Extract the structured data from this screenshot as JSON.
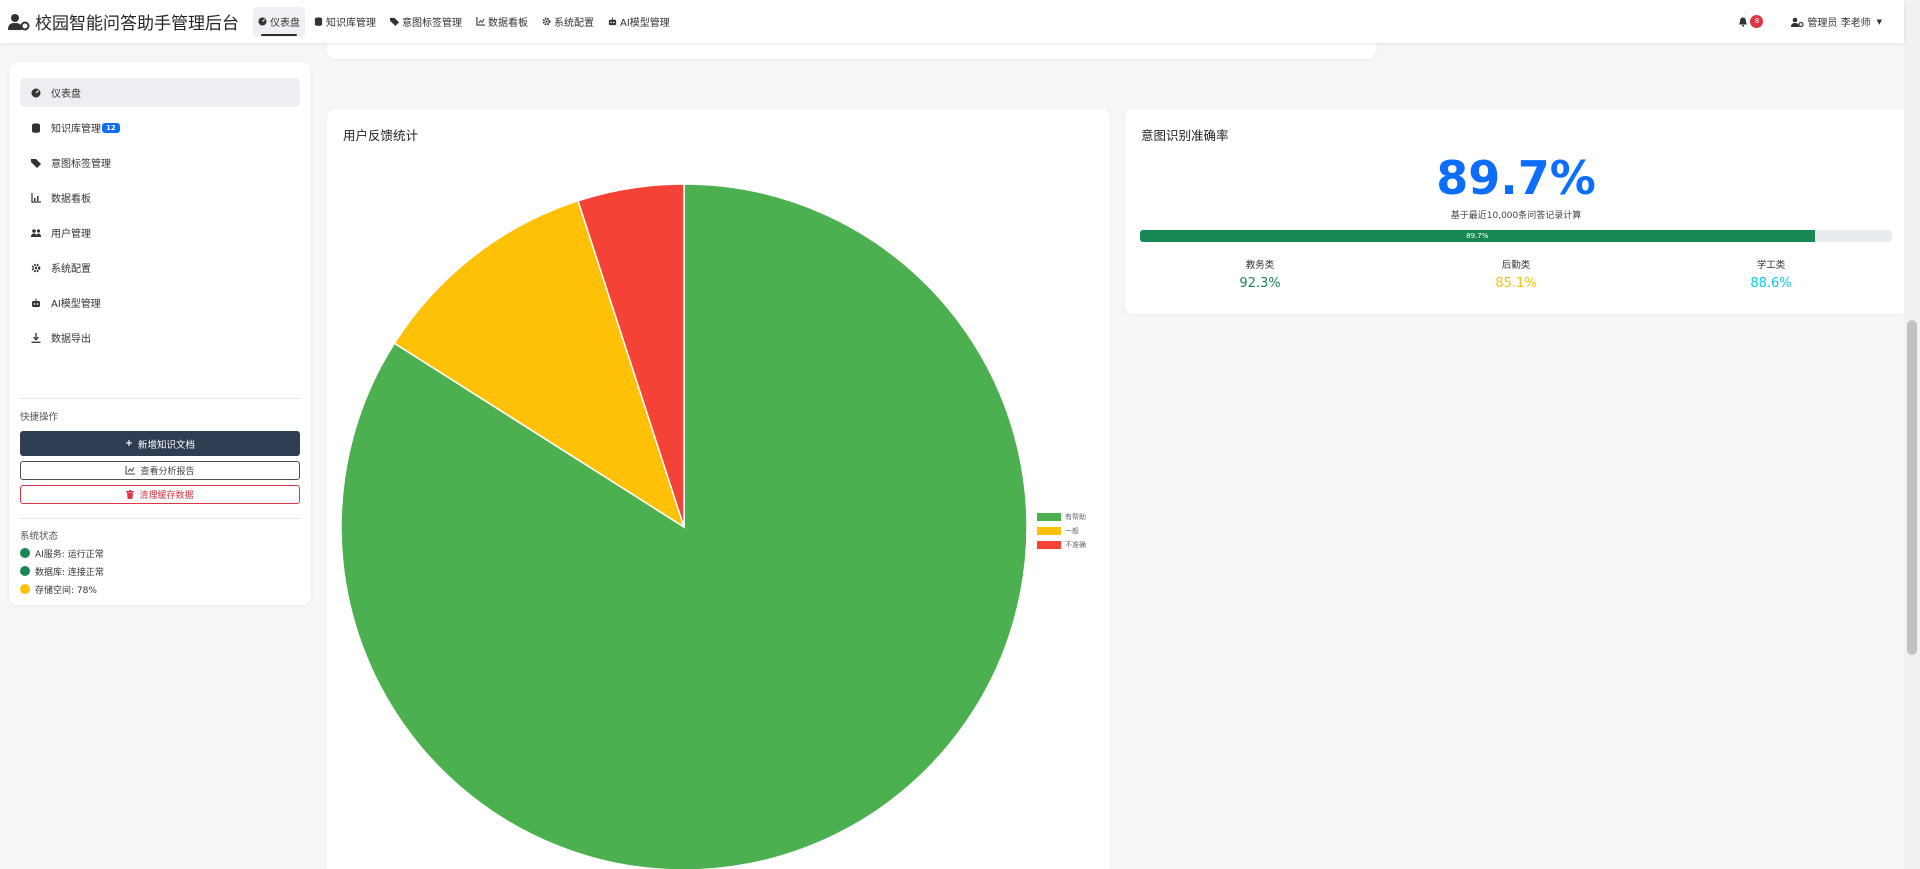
{
  "app": {
    "title": "校园智能问答助手管理后台"
  },
  "nav": {
    "links": [
      {
        "label": "仪表盘",
        "active": true
      },
      {
        "label": "知识库管理"
      },
      {
        "label": "意图标签管理"
      },
      {
        "label": "数据看板"
      },
      {
        "label": "系统配置"
      },
      {
        "label": "AI模型管理"
      }
    ],
    "notification_count": "8",
    "user_label": "管理员 李老师"
  },
  "sidebar": {
    "items": [
      {
        "label": "仪表盘",
        "icon": "gauge-icon",
        "active": true
      },
      {
        "label": "知识库管理",
        "icon": "database-icon",
        "badge": "12"
      },
      {
        "label": "意图标签管理",
        "icon": "tags-icon"
      },
      {
        "label": "数据看板",
        "icon": "chart-icon"
      },
      {
        "label": "用户管理",
        "icon": "users-icon"
      },
      {
        "label": "系统配置",
        "icon": "gear-icon"
      },
      {
        "label": "AI模型管理",
        "icon": "robot-icon"
      },
      {
        "label": "数据导出",
        "icon": "download-icon"
      }
    ],
    "quick_actions": {
      "title": "快捷操作",
      "add_doc": "新增知识文档",
      "view_report": "查看分析报告",
      "clear_cache": "清理缓存数据"
    },
    "system_status": {
      "title": "系统状态",
      "items": [
        {
          "label": "AI服务: 运行正常",
          "color": "#198754"
        },
        {
          "label": "数据库: 连接正常",
          "color": "#198754"
        },
        {
          "label": "存储空间: 78%",
          "color": "#ffc107"
        }
      ]
    }
  },
  "feedback_card": {
    "title": "用户反馈统计",
    "chart_data": {
      "type": "pie",
      "categories": [
        "有帮助",
        "一般",
        "不准确"
      ],
      "values": [
        84,
        11,
        5
      ],
      "colors": [
        "#4caf50",
        "#ffc107",
        "#f44336"
      ],
      "legend": "right"
    }
  },
  "intent_card": {
    "title": "意图识别准确率",
    "overall": "89.7%",
    "overall_value": 89.7,
    "note": "基于最近10,000条问答记录计算",
    "progress_label": "89.7%",
    "stats": [
      {
        "label": "教务类",
        "value": "92.3%",
        "color": "#198754"
      },
      {
        "label": "后勤类",
        "value": "85.1%",
        "color": "#ffc107"
      },
      {
        "label": "学工类",
        "value": "88.6%",
        "color": "#0dcaf0"
      }
    ]
  }
}
